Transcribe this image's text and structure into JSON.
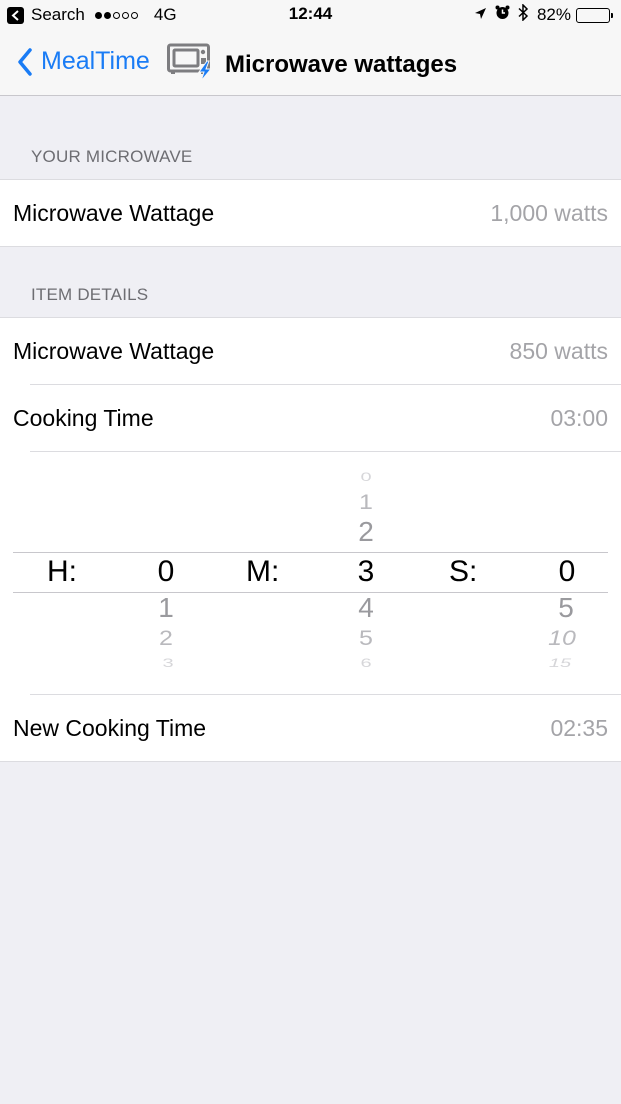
{
  "status_bar": {
    "back_app_label": "Search",
    "signal_bars_filled": 2,
    "signal_bars_total": 5,
    "network": "4G",
    "time": "12:44",
    "icons": [
      "location-arrow-icon",
      "alarm-icon",
      "bluetooth-icon"
    ],
    "battery_percent_label": "82%",
    "battery_level": 0.82
  },
  "nav": {
    "back_label": "MealTime",
    "title_icon": "microwave-power-icon",
    "title": "Microwave wattages",
    "accent_color": "#1a7cf5"
  },
  "sections": {
    "your_microwave": {
      "header": "YOUR MICROWAVE",
      "rows": [
        {
          "label": "Microwave Wattage",
          "value": "1,000 watts"
        }
      ]
    },
    "item_details": {
      "header": "ITEM DETAILS",
      "rows": [
        {
          "label": "Microwave Wattage",
          "value": "850 watts"
        },
        {
          "label": "Cooking Time",
          "value": "03:00"
        }
      ],
      "picker": {
        "hours": {
          "label": "H:",
          "above": [],
          "selected": "0",
          "below": [
            "1",
            "2",
            "3"
          ]
        },
        "minutes": {
          "label": "M:",
          "above": [
            "0",
            "1",
            "2"
          ],
          "selected": "3",
          "below": [
            "4",
            "5",
            "6"
          ]
        },
        "seconds": {
          "label": "S:",
          "above": [],
          "selected": "0",
          "below": [
            "5",
            "10",
            "15"
          ]
        }
      },
      "result_row": {
        "label": "New Cooking Time",
        "value": "02:35"
      }
    }
  }
}
